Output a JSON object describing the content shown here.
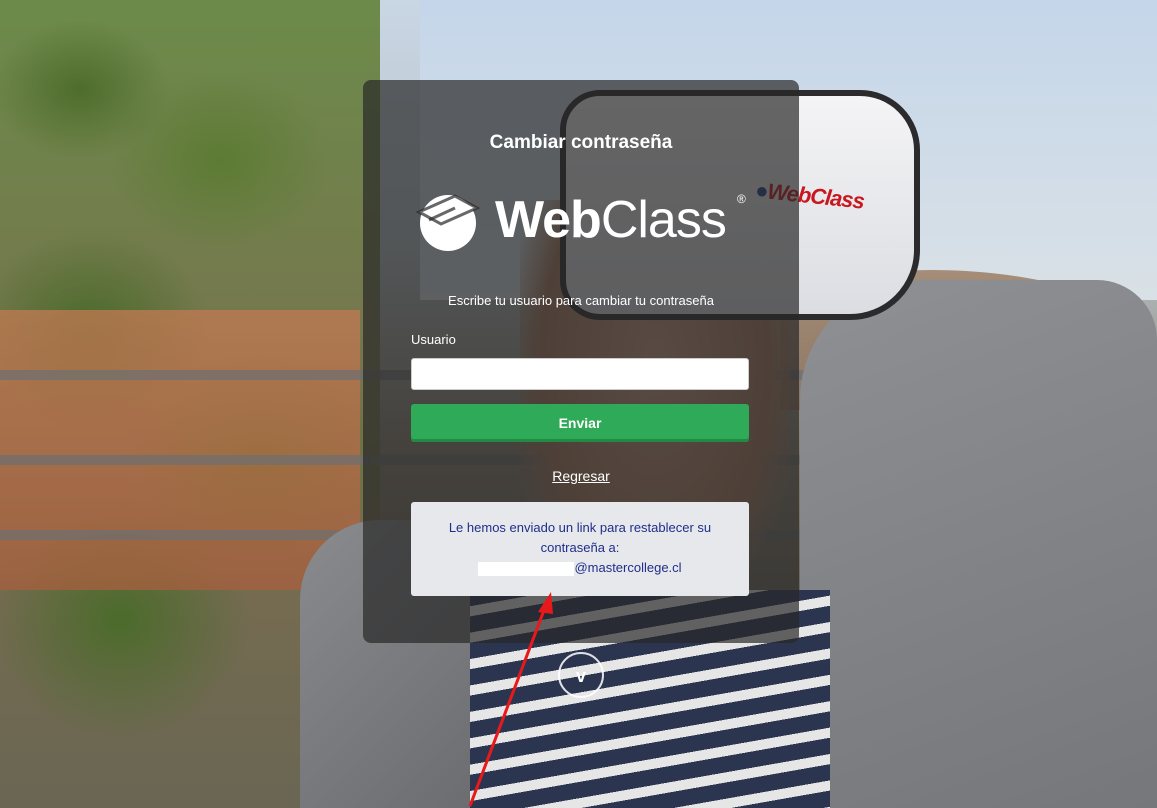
{
  "panel": {
    "title": "Cambiar contraseña",
    "instruction": "Escribe tu usuario para cambiar tu contraseña",
    "user_label": "Usuario",
    "user_value": "",
    "submit_label": "Enviar",
    "back_link": "Regresar",
    "notice_text": "Le hemos enviado un link para restablecer su contraseña a:",
    "notice_email_domain": "@mastercollege.cl"
  },
  "logo": {
    "text_bold": "Web",
    "text_light": "Class",
    "registered": "®"
  },
  "headset_logo": {
    "text": "WebClass"
  },
  "scroll_chevron": "v",
  "colors": {
    "submit_green": "#2faa58",
    "notice_text_blue": "#1f2f8a",
    "annotation_arrow": "#e8191b"
  }
}
